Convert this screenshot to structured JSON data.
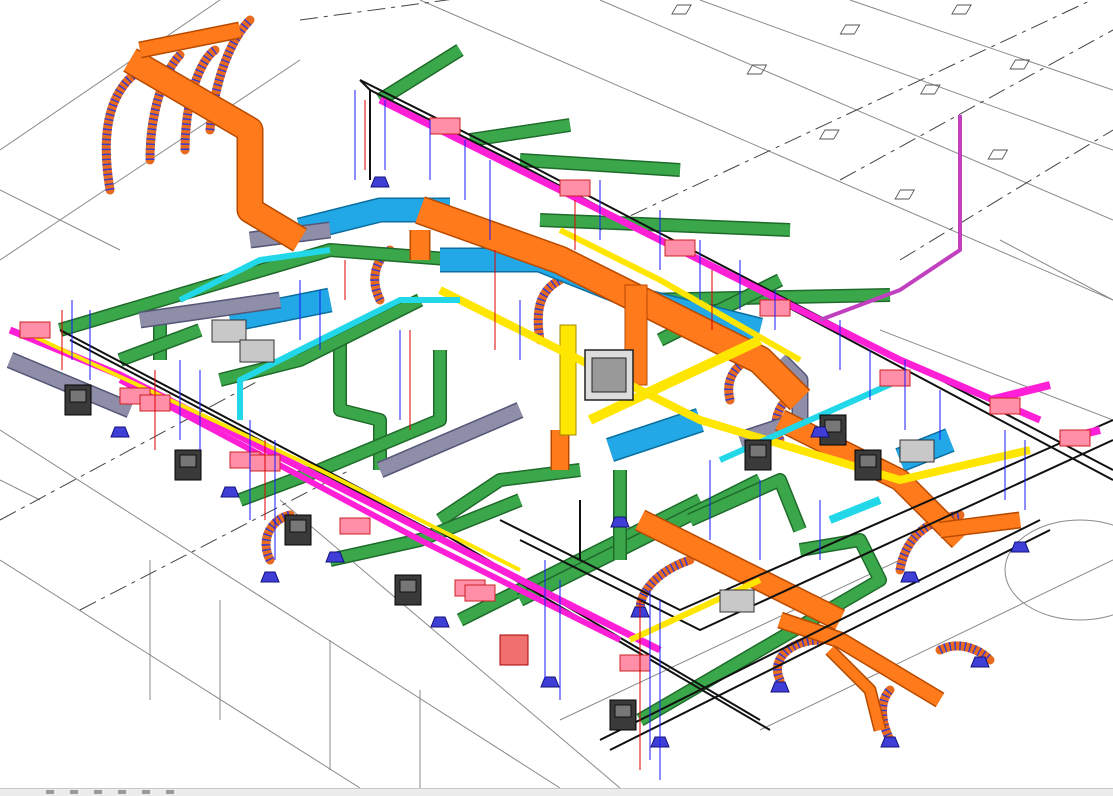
{
  "view": {
    "kind": "3D isometric MEP coordination model",
    "background": "#ffffff"
  },
  "colors": {
    "arch_line": "#8a8a8a",
    "arch_dash": "#444444",
    "supply_duct": "#ff7a1a",
    "supply_duct_edge": "#b84a00",
    "return_duct": "#22a8e6",
    "exhaust_duct": "#3aa84a",
    "exhaust_duct_edge": "#1f6b2b",
    "pink_pipe": "#ff1fd6",
    "yellow_pipe": "#ffe600",
    "cyan_pipe": "#22d7e8",
    "grey_duct": "#8e8ea8",
    "flex_duct": "#e86a1e",
    "flex_stripe": "#3b3bd0",
    "hanger_blue": "#1a1aff",
    "hanger_red": "#e00000",
    "equipment_dark": "#3a3a3a",
    "equipment_light": "#c8c8c8",
    "terminal_pink": "#ff8fa8",
    "diffuser_blue": "#3f3fd8"
  },
  "icons": [
    "view-cube-icon",
    "grid-icon",
    "zoom-icon",
    "pan-icon",
    "orbit-icon",
    "visual-style-icon"
  ]
}
